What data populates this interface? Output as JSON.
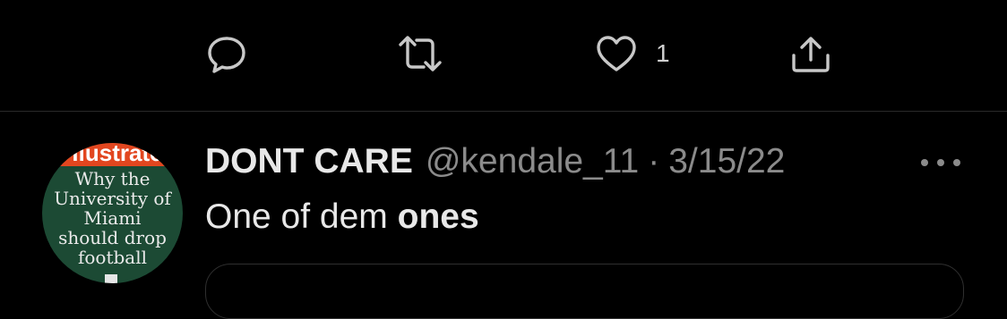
{
  "actions": {
    "reply": {
      "icon": "reply-icon"
    },
    "retweet": {
      "icon": "retweet-icon"
    },
    "like": {
      "icon": "heart-icon",
      "count": "1"
    },
    "share": {
      "icon": "share-icon"
    }
  },
  "tweet": {
    "display_name": "DONT CARE",
    "handle": "@kendale_11",
    "separator": "·",
    "date": "3/15/22",
    "text_plain": "One of dem ",
    "text_bold": "ones",
    "more_icon": "more-options-icon"
  },
  "avatar": {
    "masthead": "llustrate",
    "cover_lines": [
      "Why the",
      "University of",
      "Miami",
      "should drop",
      "football"
    ]
  },
  "colors": {
    "background": "#000000",
    "text_primary": "#e8e8e8",
    "text_secondary": "#8b8b8b",
    "divider": "#2a2a2a",
    "avatar_green": "#1c4a34",
    "avatar_masthead": "#e2461f"
  }
}
